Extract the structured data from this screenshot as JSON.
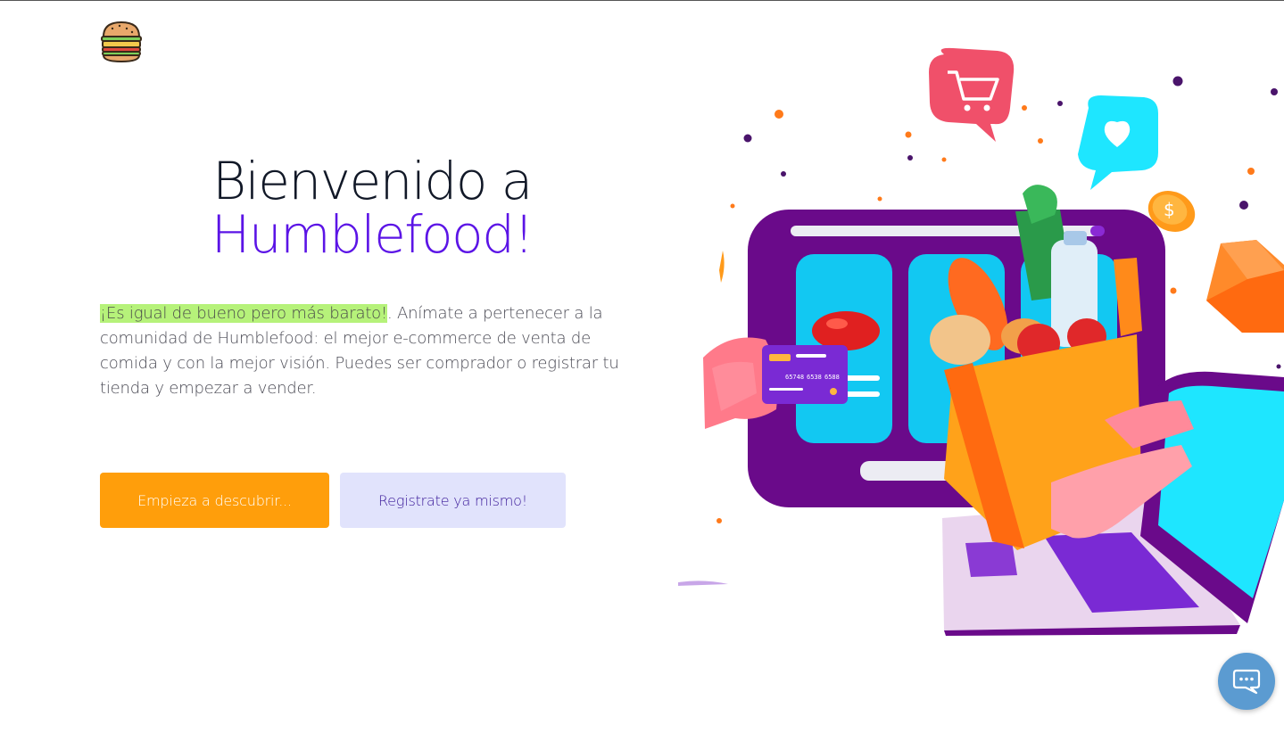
{
  "header": {
    "logo_icon": "burger-icon"
  },
  "hero": {
    "title_line1": "Bienvenido a",
    "title_line2": "Humblefood!",
    "highlight": "¡Es igual de bueno pero más barato!",
    "description": ". Anímate a pertenecer a la comunidad de Humblefood: el mejor e-commerce de venta de comida y con la mejor visión. Puedes ser comprador o registrar tu tienda y empezar a vender.",
    "primary_button": "Empieza a descubrir...",
    "secondary_button": "Registrate ya mismo!"
  },
  "illustration": {
    "card_digits": [
      "65748",
      "6538",
      "6588"
    ],
    "icons": [
      "shopping-cart-icon",
      "heart-icon",
      "dollar-coin-icon"
    ]
  },
  "chat": {
    "icon": "chat-bubble-icon"
  },
  "colors": {
    "title_accent": "#5b14e6",
    "primary_button": "#ff9e0b",
    "secondary_button": "#e1e3fc",
    "highlight": "#b6f27a",
    "chat_button": "#5b9bd1"
  }
}
